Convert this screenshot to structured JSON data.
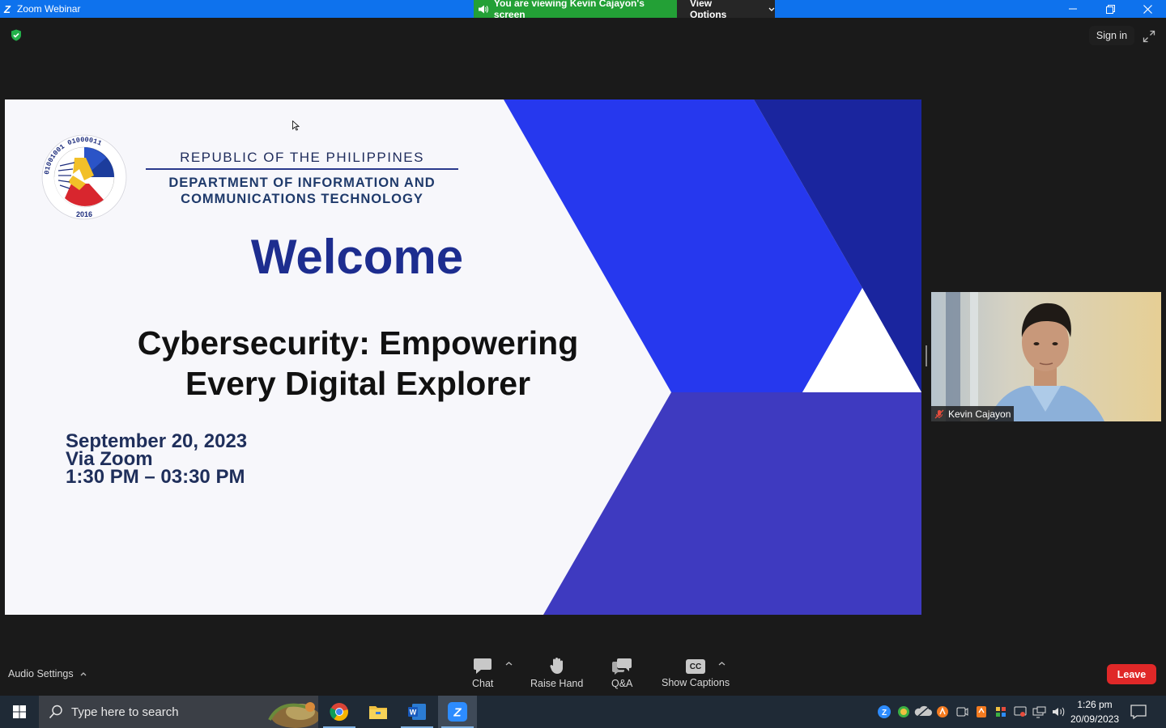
{
  "window": {
    "app_title": "Zoom Webinar",
    "share_banner": "You are viewing Kevin Cajayon's screen",
    "view_options": "View Options"
  },
  "topbar": {
    "sign_in": "Sign in"
  },
  "slide": {
    "republic": "REPUBLIC OF THE PHILIPPINES",
    "department_line1": "DEPARTMENT OF INFORMATION AND",
    "department_line2": "COMMUNICATIONS TECHNOLOGY",
    "welcome": "Welcome",
    "headline_line1": "Cybersecurity: Empowering",
    "headline_line2": "Every Digital Explorer",
    "date": "September 20, 2023",
    "venue": "Via Zoom",
    "time": "1:30 PM – 03:30 PM",
    "seal_year": "2016",
    "seal_text_top": "01001001 01000011",
    "colors": {
      "navy": "#1d2d8f",
      "blue": "#2638ee",
      "indigo": "#3e3ac0",
      "dark_blue": "#1a259e"
    }
  },
  "participant": {
    "name": "Kevin Cajayon",
    "muted_icon": "mic-muted-icon"
  },
  "toolbar": {
    "audio_settings": "Audio Settings",
    "chat": "Chat",
    "raise_hand": "Raise Hand",
    "qa": "Q&A",
    "show_captions": "Show Captions",
    "cc": "CC",
    "leave": "Leave"
  },
  "taskbar": {
    "search_placeholder": "Type here to search",
    "time": "1:26 pm",
    "date": "20/09/2023"
  }
}
